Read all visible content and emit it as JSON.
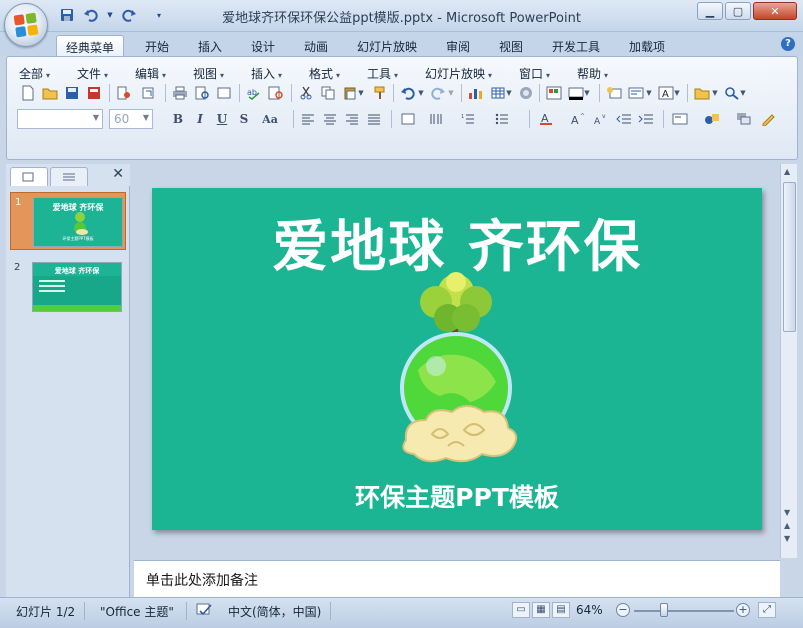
{
  "window": {
    "title": "爱地球齐环保环保公益ppt模版.pptx - Microsoft PowerPoint",
    "minimize_icon": "minimize-icon",
    "maximize_icon": "maximize-icon",
    "close_icon": "close-icon"
  },
  "quick_access": [
    "save-icon",
    "undo-icon",
    "redo-icon",
    "customize-icon"
  ],
  "tabs": [
    "经典菜单",
    "开始",
    "插入",
    "设计",
    "动画",
    "幻灯片放映",
    "审阅",
    "视图",
    "开发工具",
    "加载项"
  ],
  "active_tab": "经典菜单",
  "classic_menu": [
    "全部",
    "文件",
    "编辑",
    "视图",
    "插入",
    "格式",
    "工具",
    "幻灯片放映",
    "窗口",
    "帮助"
  ],
  "font": {
    "name": "",
    "size": "60"
  },
  "format_buttons": [
    "B",
    "I",
    "U",
    "S",
    "Aa"
  ],
  "slides": [
    {
      "number": "1",
      "title": "爱地球 齐环保",
      "subtitle": "环保主题PPT模板"
    },
    {
      "number": "2",
      "title": "爱地球 齐环保"
    }
  ],
  "current_slide": {
    "title": "爱地球 齐环保",
    "subtitle": "环保主题PPT模板",
    "background": "#1bb594"
  },
  "notes_placeholder": "单击此处添加备注",
  "status": {
    "slide_info": "幻灯片 1/2",
    "theme": "\"Office 主题\"",
    "language": "中文(简体，中国)",
    "zoom": "64%"
  }
}
